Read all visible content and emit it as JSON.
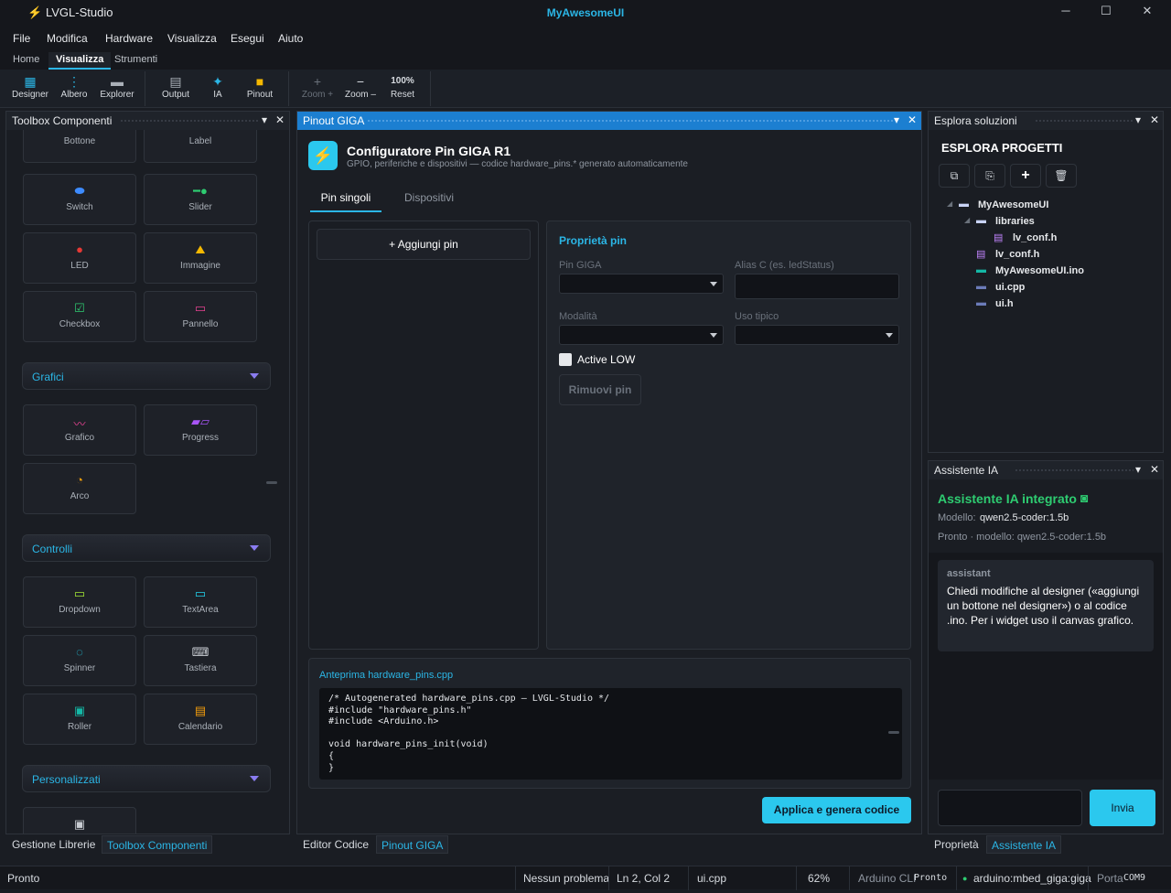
{
  "window": {
    "app_title": "LVGL-Studio",
    "project_title": "MyAwesomeUI",
    "minimize": "─",
    "maximize": "☐",
    "close": "✕"
  },
  "menu": [
    "File",
    "Modifica",
    "Hardware",
    "Visualizza",
    "Esegui",
    "Aiuto"
  ],
  "ribbon_tabs": [
    "Home",
    "Visualizza",
    "Strumenti"
  ],
  "ribbon": {
    "designer": "Designer",
    "albero": "Albero",
    "explorer": "Explorer",
    "output": "Output",
    "ia": "IA",
    "pinout": "Pinout",
    "zoom_in": "Zoom +",
    "zoom_out": "Zoom –",
    "reset": "Reset",
    "zoom_level": "100%"
  },
  "toolbox": {
    "title": "Toolbox Componenti",
    "widgets_top": [
      "Bottone",
      "Label",
      "Switch",
      "Slider",
      "LED",
      "Immagine",
      "Checkbox",
      "Pannello"
    ],
    "cat_grafici": "Grafici",
    "widgets_grafici": [
      "Grafico",
      "Progress",
      "Arco"
    ],
    "cat_controlli": "Controlli",
    "widgets_controlli": [
      "Dropdown",
      "TextArea",
      "Spinner",
      "Tastiera",
      "Roller",
      "Calendario"
    ],
    "cat_personalizzati": "Personalizzati",
    "bottom_tabs": [
      "Gestione Librerie",
      "Toolbox Componenti"
    ]
  },
  "pinout": {
    "title": "Pinout GIGA",
    "header_title": "Configuratore Pin GIGA R1",
    "header_subtitle": "GPIO, periferiche e dispositivi — codice hardware_pins.* generato automaticamente",
    "tabs": [
      "Pin singoli",
      "Dispositivi"
    ],
    "add_pin": "+ Aggiungi pin",
    "props_title": "Proprietà pin",
    "label_pin": "Pin GIGA",
    "label_alias": "Alias C (es. ledStatus)",
    "label_mode": "Modalità",
    "label_usage": "Uso tipico",
    "active_low": "Active LOW",
    "remove_pin": "Rimuovi pin",
    "preview_title": "Anteprima hardware_pins.cpp",
    "code": [
      "/* Autogenerated hardware_pins.cpp — LVGL-Studio */",
      "#include \"hardware_pins.h\"",
      "#include <Arduino.h>",
      "",
      "void hardware_pins_init(void)",
      "{",
      "}"
    ],
    "apply": "Applica e genera codice",
    "bottom_tabs": [
      "Editor Codice",
      "Pinout GIGA"
    ]
  },
  "explorer": {
    "title": "Esplora soluzioni",
    "heading": "ESPLORA PROGETTI",
    "tree": [
      "MyAwesomeUI",
      "libraries",
      "lv_conf.h",
      "lv_conf.h",
      "MyAwesomeUI.ino",
      "ui.cpp",
      "ui.h"
    ]
  },
  "assistant": {
    "title": "Assistente IA",
    "heading": "Assistente IA integrato",
    "model_label": "Modello:",
    "model_value": "qwen2.5-coder:1.5b",
    "status": "Pronto · modello: qwen2.5-coder:1.5b",
    "role": "assistant",
    "message": "Chiedi modifiche al designer («aggiungi un bottone nel designer») o al codice .ino. Per i widget uso il canvas grafico.",
    "send": "Invia",
    "bottom_tabs": [
      "Proprietà",
      "Assistente IA"
    ]
  },
  "status": {
    "ready": "Pronto",
    "problems": "Nessun problema",
    "position": "Ln 2, Col 2",
    "file": "ui.cpp",
    "zoom": "62%",
    "cli_label": "Arduino CLI",
    "cli_value": "Pronto",
    "board": "arduino:mbed_giga:giga",
    "port_label": "Porta",
    "port_value": "COM9"
  },
  "colors": {
    "accent": "#2bb6e6",
    "panel_header_active": "#1c7fd1",
    "ai_heading": "#2ecc71",
    "apply_button": "#2bc8ee"
  }
}
